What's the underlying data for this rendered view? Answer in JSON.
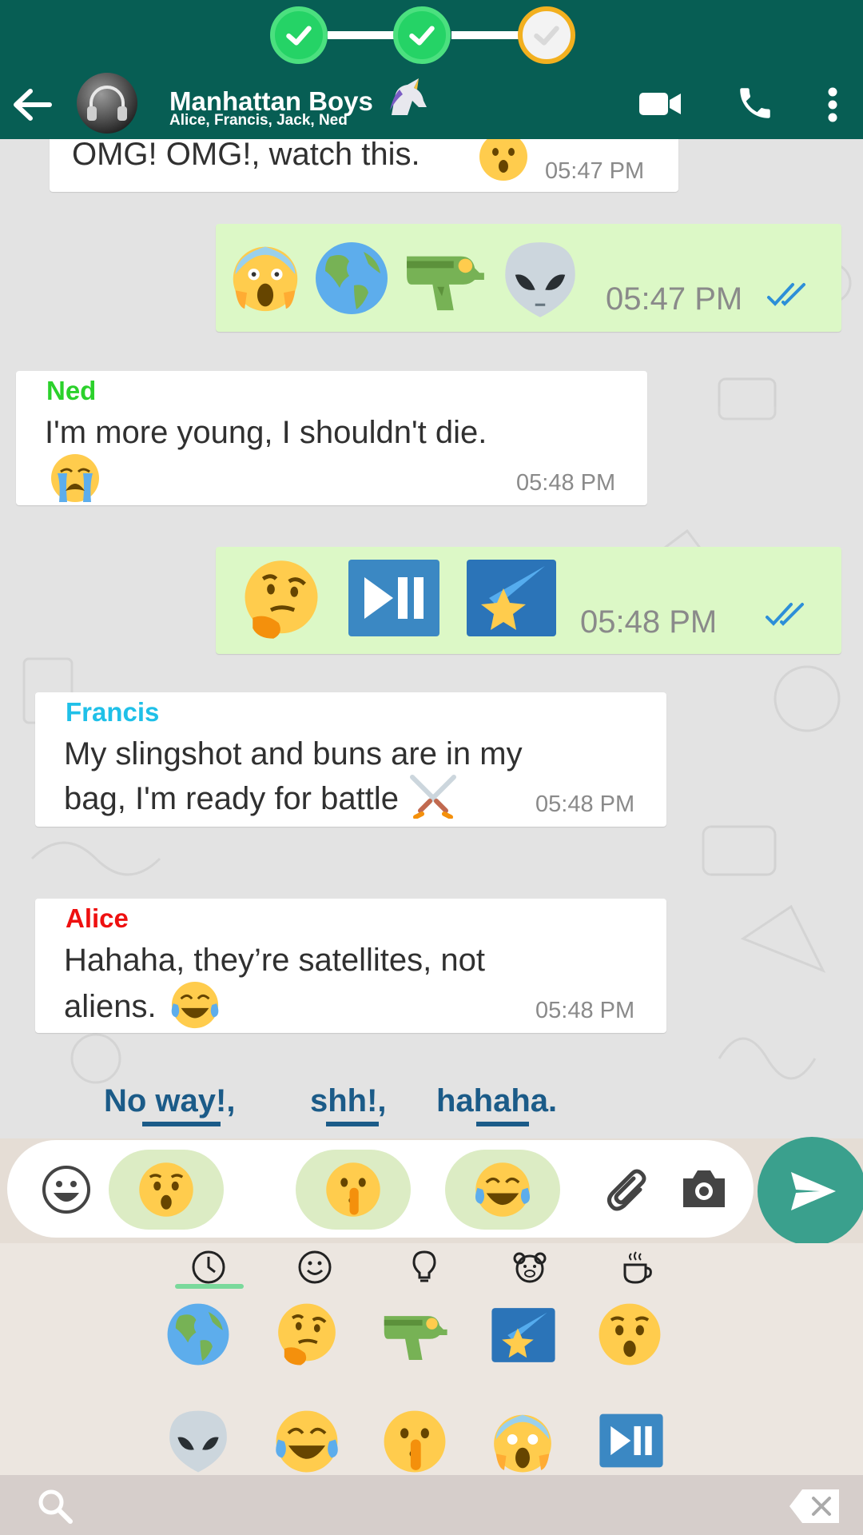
{
  "colors": {
    "header": "#075e54",
    "incoming_bubble": "#ffffff",
    "outgoing_bubble": "#dcf8c6",
    "ned": "#2bd12b",
    "francis": "#1fc0e8",
    "alice": "#ee1010",
    "send": "#3aa08d",
    "read_ticks": "#2d8fd8"
  },
  "progress": {
    "steps": [
      "done",
      "done",
      "current"
    ]
  },
  "header": {
    "title": "Manhattan Boys",
    "title_emoji": "unicorn",
    "subtitle": "Alice, Francis, Jack, Ned",
    "icons": [
      "back-arrow-icon",
      "video-call-icon",
      "phone-icon",
      "more-options-icon"
    ]
  },
  "messages": [
    {
      "type": "incoming",
      "text": "OMG! OMG!, watch this.",
      "emoji": "hushed-face",
      "time": "05:47 PM"
    },
    {
      "type": "outgoing",
      "emojis": [
        "face-screaming-in-fear",
        "globe-americas",
        "water-pistol",
        "alien"
      ],
      "time": "05:47 PM",
      "read": true
    },
    {
      "type": "incoming",
      "sender": "Ned",
      "text": "I'm more young, I shouldn't die.",
      "emoji": "loudly-crying-face",
      "time": "05:48 PM"
    },
    {
      "type": "outgoing",
      "emojis": [
        "thinking-face",
        "play-pause-button",
        "shooting-star"
      ],
      "time": "05:48 PM",
      "read": true
    },
    {
      "type": "incoming",
      "sender": "Francis",
      "text": "My slingshot and buns are in my bag, I'm ready for battle",
      "emoji": "crossed-swords",
      "time": "05:48 PM"
    },
    {
      "type": "incoming",
      "sender": "Alice",
      "text": "Hahaha, they’re satellites, not aliens.",
      "emoji": "face-with-tears-of-joy",
      "time": "05:48 PM"
    }
  ],
  "suggestions": [
    "No way!,",
    "shh!,",
    "hahaha."
  ],
  "input": {
    "emoji_chips": [
      "hushed-face",
      "shushing-face",
      "face-with-tears-of-joy"
    ],
    "icons": [
      "emoji-icon",
      "attach-icon",
      "camera-icon",
      "send-icon"
    ]
  },
  "keyboard": {
    "tabs": [
      "recent-icon",
      "smileys-icon",
      "objects-icon",
      "animals-icon",
      "food-icon"
    ],
    "active_tab": "recent-icon",
    "recent_emojis": [
      "globe-americas",
      "thinking-face",
      "water-pistol",
      "shooting-star",
      "hushed-face",
      "alien",
      "face-with-tears-of-joy",
      "shushing-face",
      "face-screaming-in-fear",
      "play-pause-button"
    ],
    "bottom_icons": [
      "search-icon",
      "backspace-icon"
    ]
  }
}
